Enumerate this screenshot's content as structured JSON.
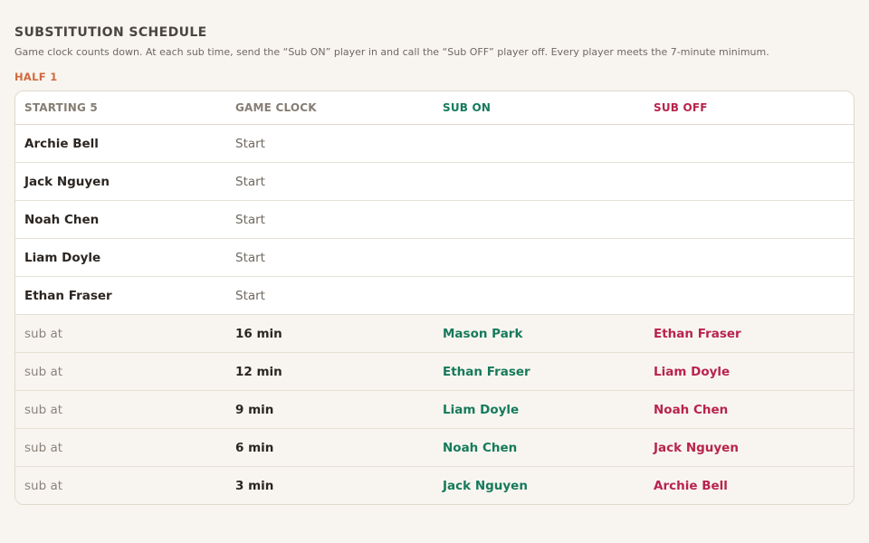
{
  "header": {
    "title": "SUBSTITUTION SCHEDULE",
    "description": "Game clock counts down. At each sub time, send the “Sub ON” player in and call the “Sub OFF” player off. Every player meets the 7-minute minimum.",
    "half_label": "HALF 1"
  },
  "table": {
    "columns": [
      "STARTING 5",
      "GAME CLOCK",
      "SUB ON",
      "SUB OFF"
    ],
    "starters": [
      {
        "player": "Archie Bell",
        "clock": "Start"
      },
      {
        "player": "Jack Nguyen",
        "clock": "Start"
      },
      {
        "player": "Noah Chen",
        "clock": "Start"
      },
      {
        "player": "Liam Doyle",
        "clock": "Start"
      },
      {
        "player": "Ethan Fraser",
        "clock": "Start"
      }
    ],
    "subs": [
      {
        "label": "sub at",
        "clock": "16 min",
        "on": "Mason Park",
        "off": "Ethan Fraser"
      },
      {
        "label": "sub at",
        "clock": "12 min",
        "on": "Ethan Fraser",
        "off": "Liam Doyle"
      },
      {
        "label": "sub at",
        "clock": "9 min",
        "on": "Liam Doyle",
        "off": "Noah Chen"
      },
      {
        "label": "sub at",
        "clock": "6 min",
        "on": "Noah Chen",
        "off": "Jack Nguyen"
      },
      {
        "label": "sub at",
        "clock": "3 min",
        "on": "Jack Nguyen",
        "off": "Archie Bell"
      }
    ]
  },
  "colors": {
    "background": "#f8f5f0",
    "half_accent": "#d06a3d",
    "sub_on": "#167a5c",
    "sub_off": "#b8244c"
  }
}
